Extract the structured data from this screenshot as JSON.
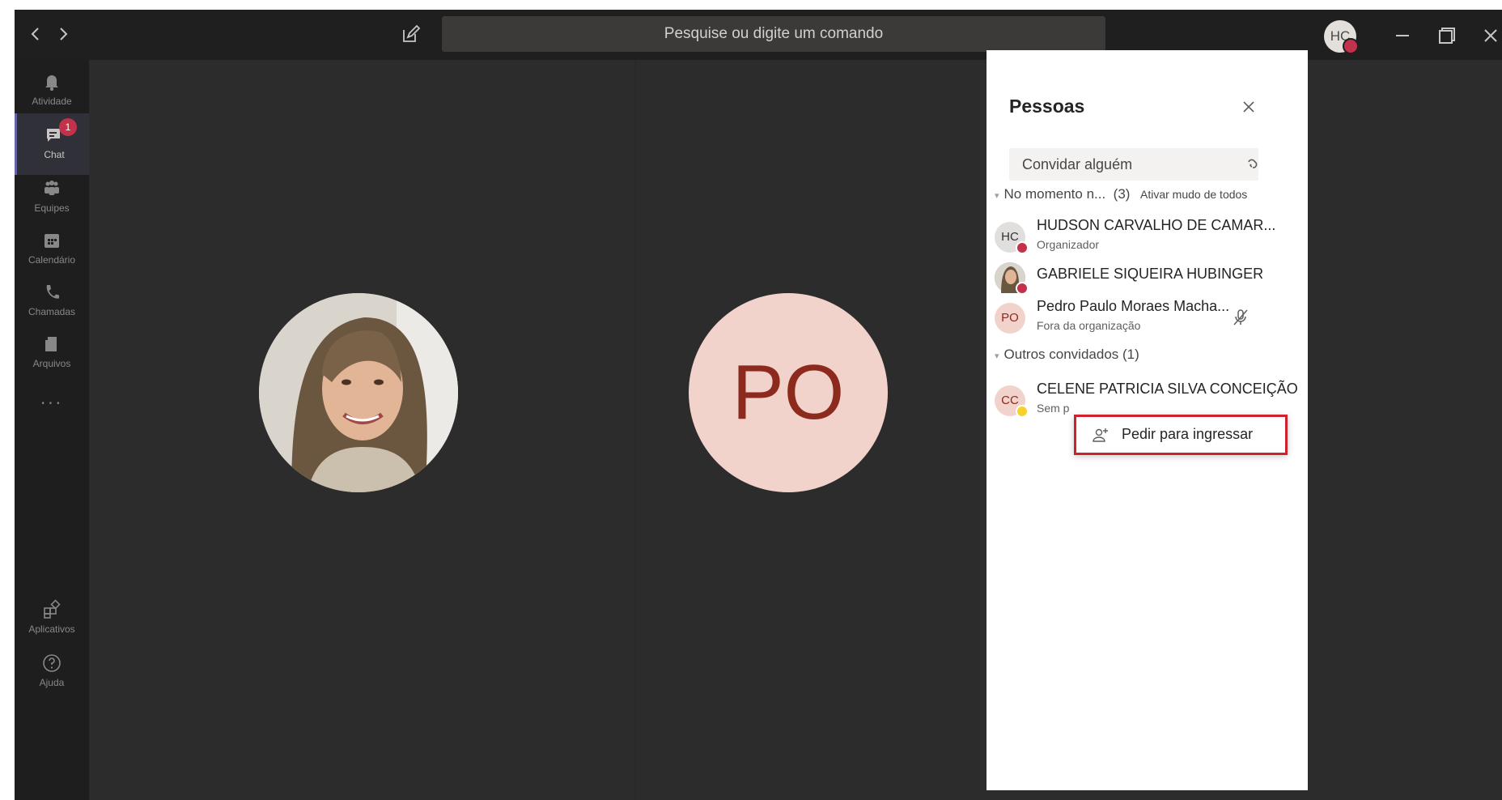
{
  "titlebar": {
    "back_icon": "chevron-left-icon",
    "forward_icon": "chevron-right-icon",
    "compose_icon": "compose-icon",
    "search_placeholder": "Pesquise ou digite um comando",
    "user_initials": "HC",
    "minimize_icon": "minimize-icon",
    "maximize_icon": "maximize-icon",
    "close_icon": "close-icon"
  },
  "rail": {
    "items": [
      {
        "label": "Atividade",
        "icon": "bell-icon"
      },
      {
        "label": "Chat",
        "icon": "chat-icon",
        "badge": "1",
        "active": true
      },
      {
        "label": "Equipes",
        "icon": "teams-icon"
      },
      {
        "label": "Calendário",
        "icon": "calendar-icon"
      },
      {
        "label": "Chamadas",
        "icon": "phone-icon"
      },
      {
        "label": "Arquivos",
        "icon": "files-icon"
      }
    ],
    "more": "...",
    "apps_label": "Aplicativos",
    "help_label": "Ajuda"
  },
  "stage": {
    "participant_initials": "PO"
  },
  "people_panel": {
    "title": "Pessoas",
    "invite_placeholder": "Convidar alguém",
    "section_current": "No momento n...",
    "section_current_count": "(3)",
    "mute_all": "Ativar mudo de todos",
    "section_others": "Outros convidados (1)",
    "participants": [
      {
        "initials": "HC",
        "name": "HUDSON CARVALHO DE CAMAR...",
        "subtitle": "Organizador",
        "status_color": "#c4314b"
      },
      {
        "initials": "",
        "name": "GABRIELE SIQUEIRA HUBINGER",
        "subtitle": "",
        "status_color": "#c4314b"
      },
      {
        "initials": "PO",
        "name": "Pedro Paulo Moraes Macha...",
        "subtitle": "Fora da organização"
      }
    ],
    "invitees": [
      {
        "initials": "CC",
        "name": "CELENE PATRICIA SILVA CONCEIÇÃO",
        "subtitle": "Sem p",
        "status_color": "#f8d22a"
      }
    ],
    "context_menu": {
      "label": "Pedir para ingressar",
      "icon": "add-person-icon"
    }
  },
  "colors": {
    "app_bg": "#2d2c2c",
    "titlebar_bg": "#201f1f",
    "accent": "#6264a7",
    "highlight_border": "#d0202d",
    "po_avatar_bg": "#f2d3cc",
    "po_avatar_text": "#8c2a1e"
  }
}
